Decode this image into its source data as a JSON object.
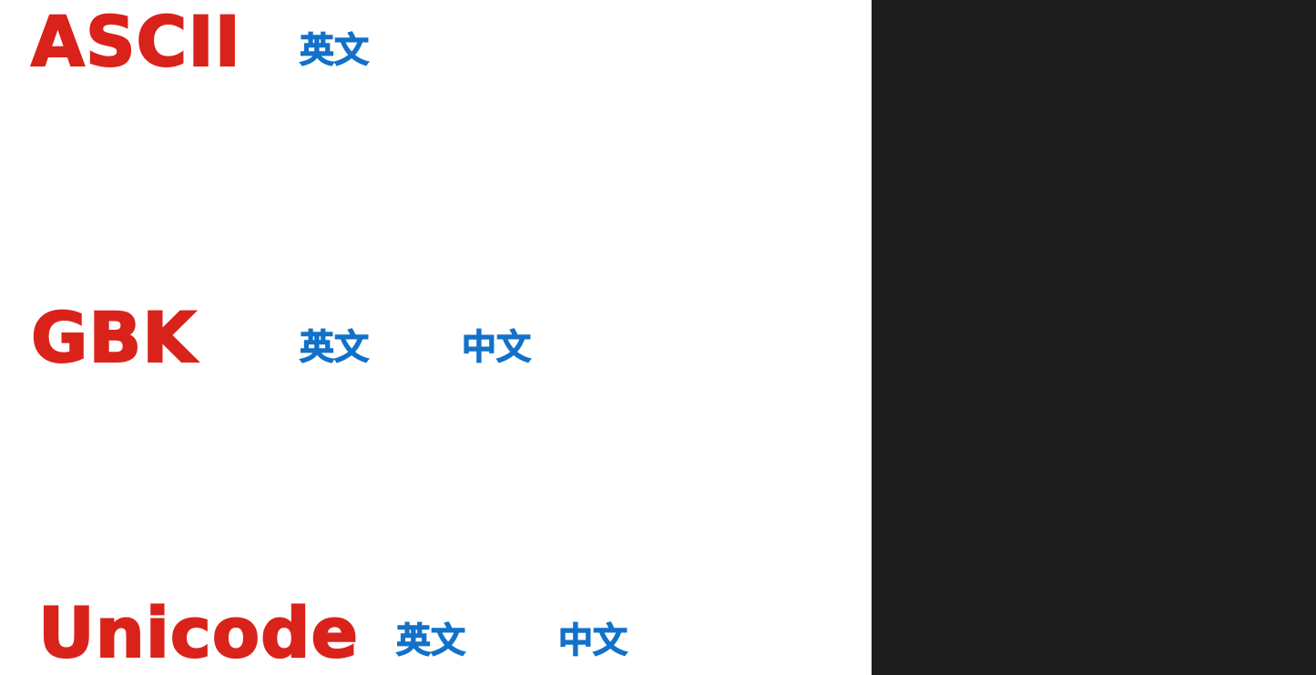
{
  "colors": {
    "title_red": "#d9231a",
    "label_blue": "#1271c9",
    "background_white": "#ffffff",
    "panel_dark": "#1c1c1c"
  },
  "rows": {
    "ascii": {
      "title": "ASCII",
      "labels": [
        "英文"
      ]
    },
    "gbk": {
      "title": "GBK",
      "labels": [
        "英文",
        "中文"
      ]
    },
    "unicode": {
      "title": "Unicode",
      "labels": [
        "英文",
        "中文"
      ]
    }
  }
}
